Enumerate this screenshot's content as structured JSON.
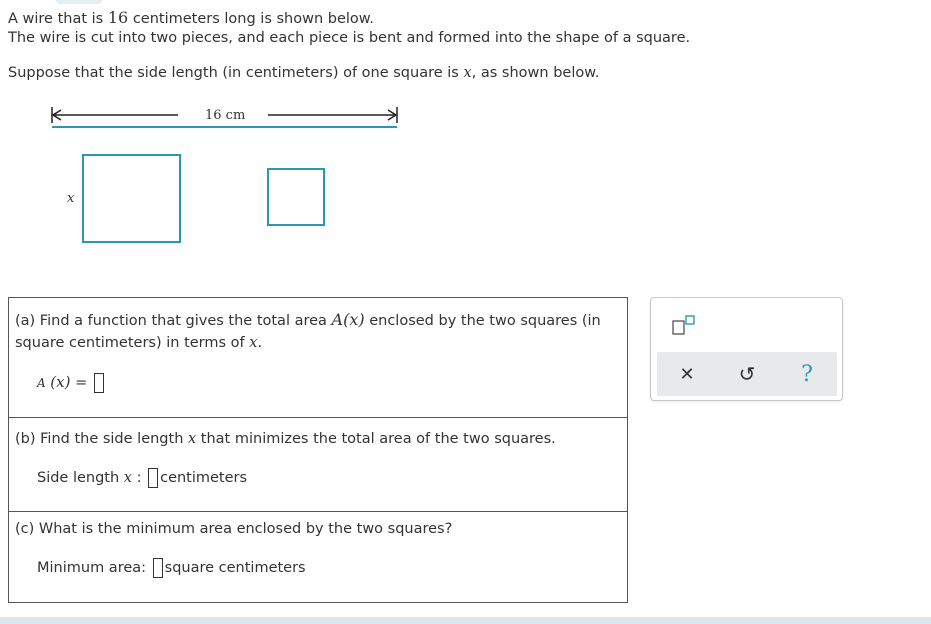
{
  "intro": {
    "line1_before": "A wire that is",
    "line1_num": "16",
    "line1_after": "centimeters long is shown below.",
    "line2": "The wire is cut into two pieces, and each piece is bent and formed into the shape of a square.",
    "line3_before": "Suppose that the side length (in centimeters) of one square is",
    "line3_var": "x",
    "line3_after": ", as shown below."
  },
  "figure": {
    "wire_label": "16 cm",
    "side_label": "x",
    "accent": "#2a98b5"
  },
  "part_a": {
    "text_before": "(a) Find a function that gives the total area",
    "func_name": "A",
    "func_arg": "(x)",
    "text_mid": "enclosed by the two squares (in",
    "text_line2_before": "square centimeters) in terms of",
    "var": "x",
    "text_line2_after": ".",
    "answer_lhs_name": "A",
    "answer_lhs_arg": "(x)",
    "answer_eq": "="
  },
  "part_b": {
    "text_before": "(b) Find the side length",
    "var": "x",
    "text_after": "that minimizes the total area of the two squares.",
    "answer_label_before": "Side length",
    "answer_var": "x",
    "answer_colon": ":",
    "answer_unit": "centimeters"
  },
  "part_c": {
    "text": "(c) What is the minimum area enclosed by the two squares?",
    "answer_label": "Minimum area:",
    "answer_unit": "square centimeters"
  },
  "toolbar": {
    "template_icon": "superscript-template-icon",
    "clear_icon": "close-icon",
    "undo_icon": "undo-icon",
    "help_icon": "help-icon",
    "clear_glyph": "✕",
    "undo_glyph": "↺",
    "help_glyph": "?",
    "icon_color": "#2a98b5"
  }
}
